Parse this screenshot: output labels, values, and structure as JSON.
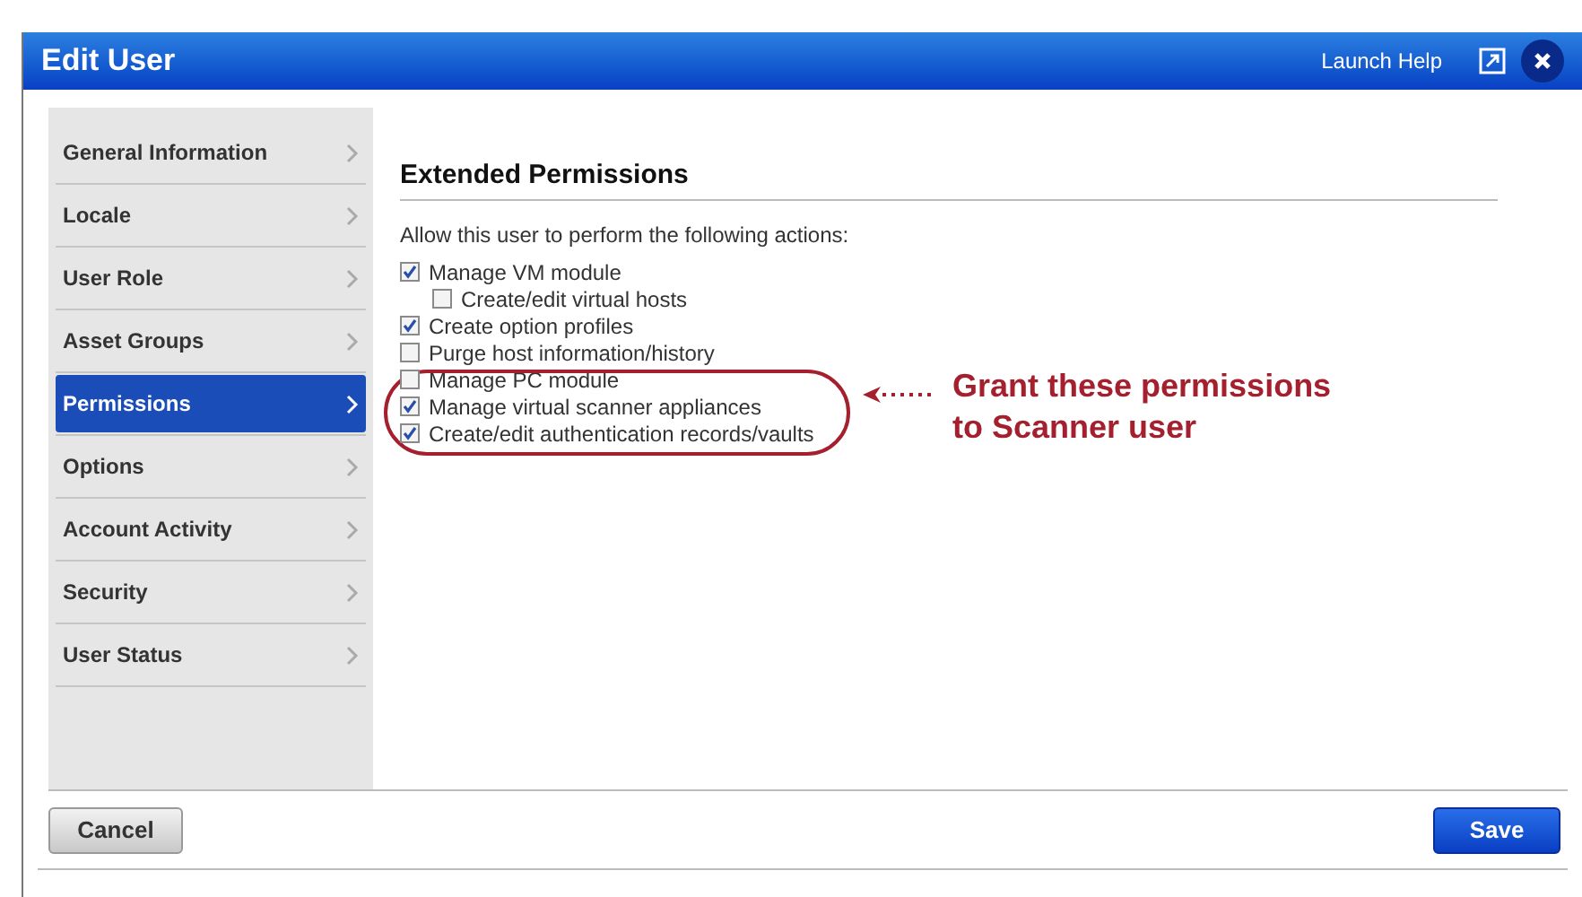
{
  "window": {
    "title": "Edit User",
    "help_link": "Launch Help"
  },
  "sidebar": {
    "items": [
      {
        "label": "General Information",
        "selected": false
      },
      {
        "label": "Locale",
        "selected": false
      },
      {
        "label": "User Role",
        "selected": false
      },
      {
        "label": "Asset Groups",
        "selected": false
      },
      {
        "label": "Permissions",
        "selected": true
      },
      {
        "label": "Options",
        "selected": false
      },
      {
        "label": "Account Activity",
        "selected": false
      },
      {
        "label": "Security",
        "selected": false
      },
      {
        "label": "User Status",
        "selected": false
      }
    ]
  },
  "section": {
    "title": "Extended Permissions",
    "intro": "Allow this user to perform the following actions:",
    "permissions": [
      {
        "label": "Manage VM module",
        "checked": true,
        "children": [
          {
            "label": "Create/edit virtual hosts",
            "checked": false
          }
        ]
      },
      {
        "label": "Create option profiles",
        "checked": true
      },
      {
        "label": "Purge host information/history",
        "checked": false
      },
      {
        "label": "Manage PC module",
        "checked": false
      },
      {
        "label": "Manage virtual scanner appliances",
        "checked": true
      },
      {
        "label": "Create/edit authentication records/vaults",
        "checked": true
      }
    ]
  },
  "annotation": {
    "lines": [
      "Grant these permissions",
      "to Scanner user"
    ]
  },
  "buttons": {
    "cancel": "Cancel",
    "save": "Save"
  }
}
